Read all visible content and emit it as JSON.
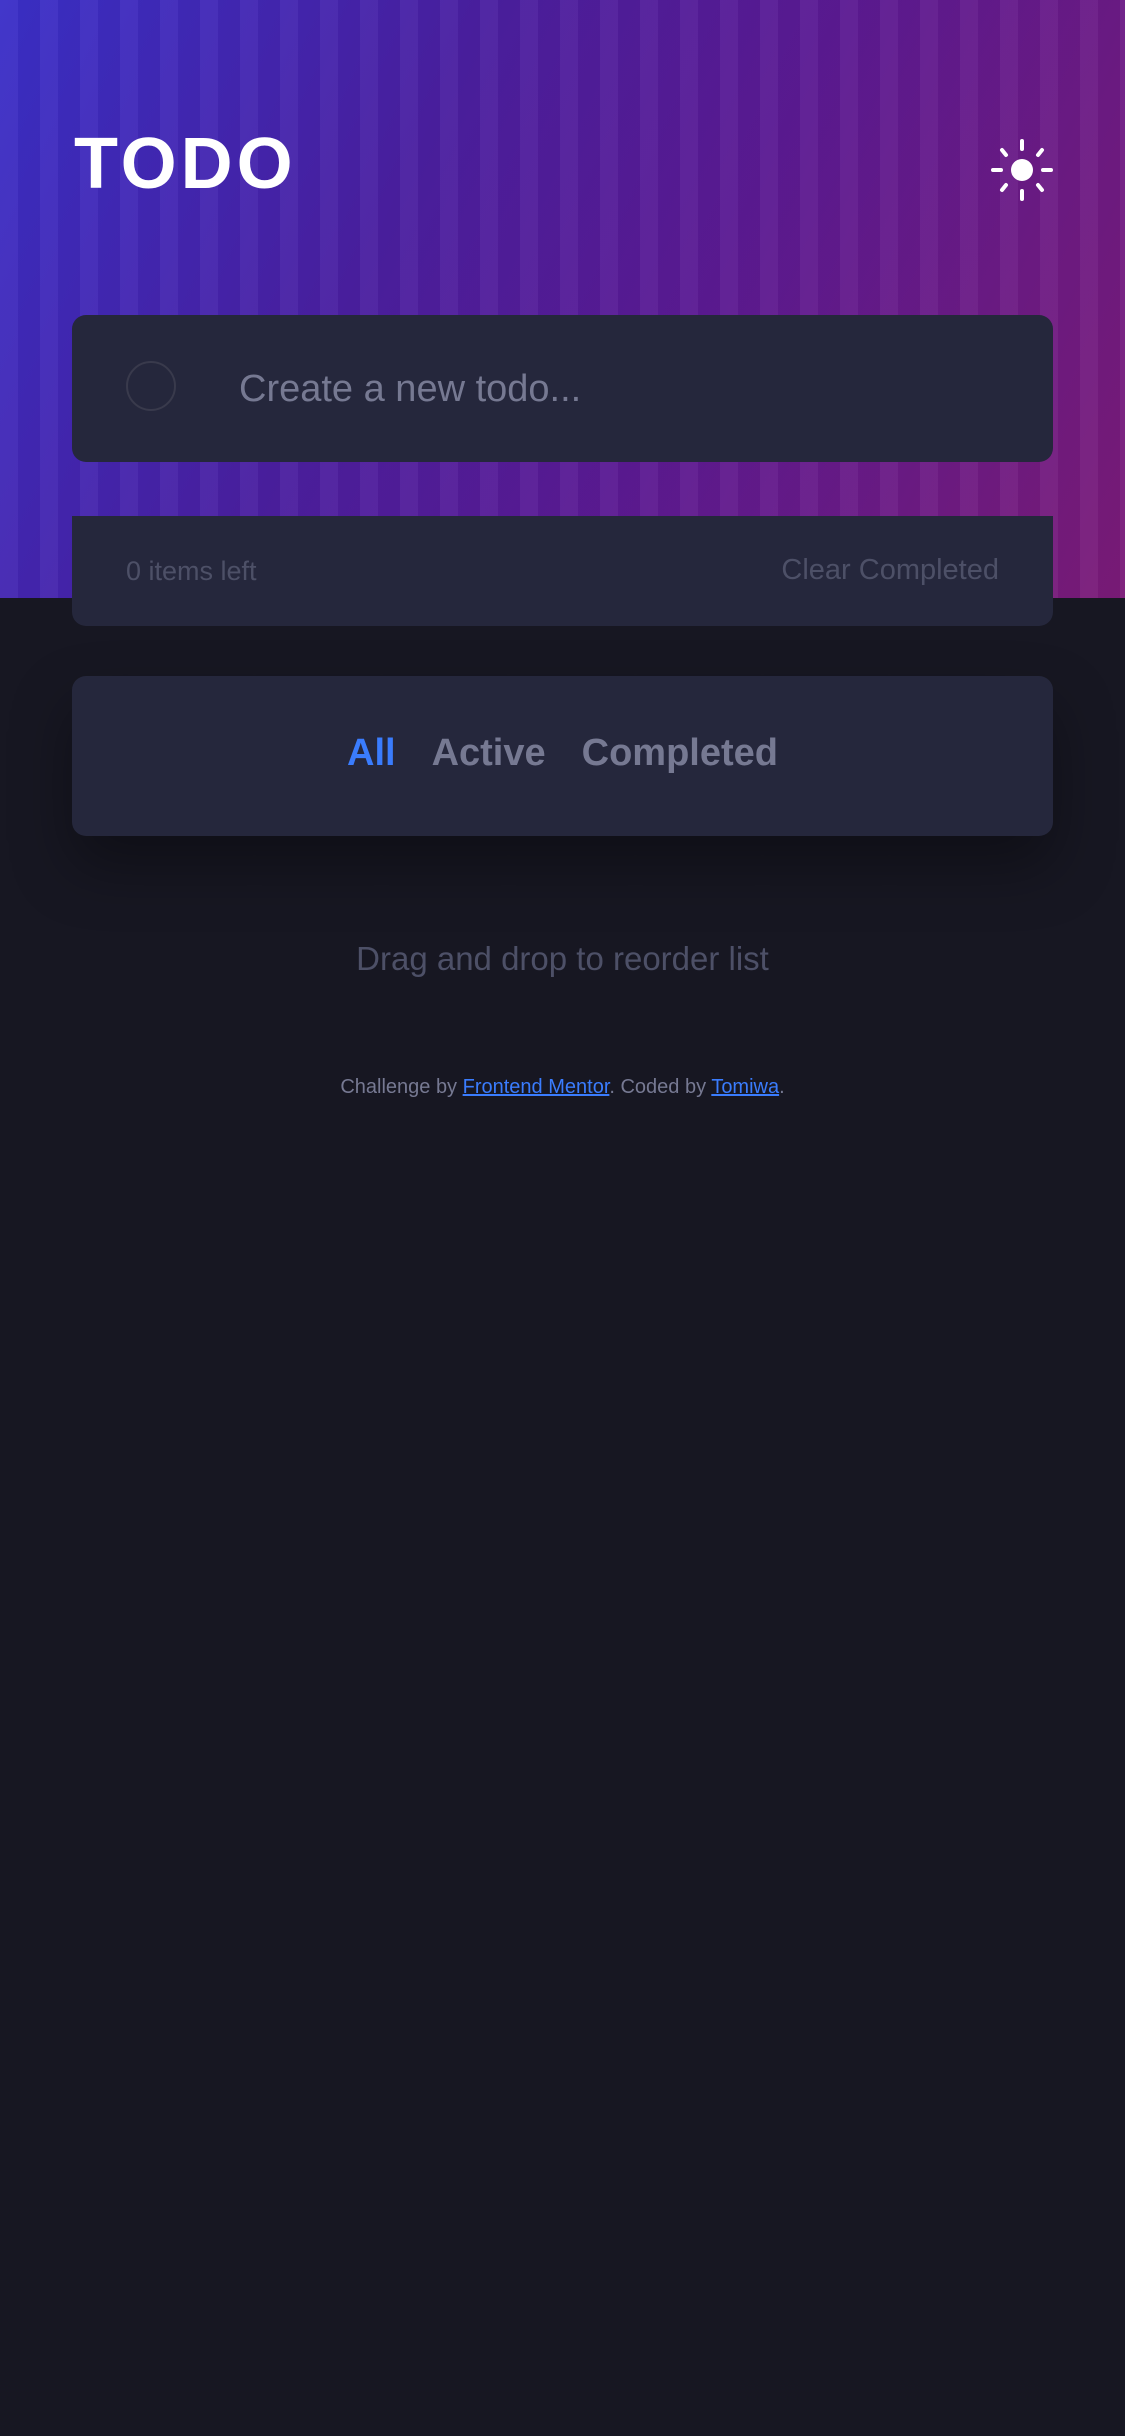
{
  "header": {
    "title": "TODO",
    "theme_toggle_icon": "sun-icon"
  },
  "new_todo": {
    "placeholder": "Create a new todo...",
    "value": ""
  },
  "list_footer": {
    "items_left": "0 items left",
    "clear_completed": "Clear Completed"
  },
  "filters": [
    {
      "label": "All",
      "active": true
    },
    {
      "label": "Active",
      "active": false
    },
    {
      "label": "Completed",
      "active": false
    }
  ],
  "hint": "Drag and drop to reorder list",
  "attribution": {
    "prefix": "Challenge by ",
    "link1": "Frontend Mentor",
    "middle": ". Coded by ",
    "link2": "Tomiwa",
    "suffix": "."
  },
  "colors": {
    "accent": "#3a7cfd",
    "background": "#171722",
    "card": "#25273c"
  }
}
